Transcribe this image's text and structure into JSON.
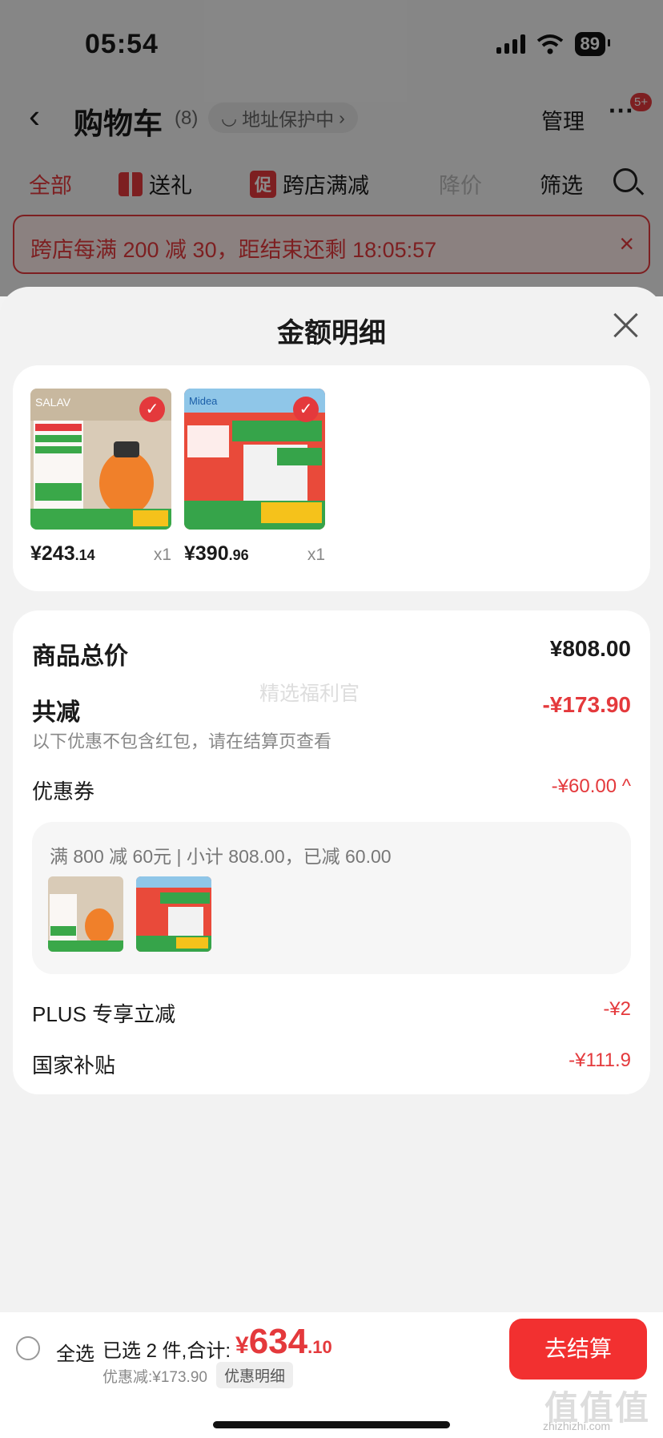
{
  "status": {
    "time": "05:54",
    "battery": "89"
  },
  "nav": {
    "back": "‹",
    "title": "购物车",
    "count": "(8)",
    "address_protect": "地址保护中",
    "manage": "管理",
    "more": "···",
    "badge": "5+"
  },
  "tabs": {
    "all": "全部",
    "gift": "送礼",
    "promo_tag": "促",
    "promo": "跨店满减",
    "drop": "降价",
    "filter": "筛选"
  },
  "banner": {
    "text": "跨店每满 200 减 30，距结束还剩 18:05:57",
    "close": "×"
  },
  "sheet": {
    "title": "金额明细",
    "products": [
      {
        "price_int": "¥243",
        "price_dec": ".14",
        "qty": "x1",
        "brand": "SALAV",
        "img_colors": [
          "#d9cbb7",
          "#f0802a",
          "#3aa849"
        ]
      },
      {
        "price_int": "¥390",
        "price_dec": ".96",
        "qty": "x1",
        "brand": "Midea",
        "img_colors": [
          "#e94a3a",
          "#f2f2f2",
          "#36a44a"
        ]
      }
    ],
    "summary": {
      "goods_total_label": "商品总价",
      "goods_total": "¥808.00",
      "total_reduce_label": "共减",
      "total_reduce": "-¥173.90",
      "note": "以下优惠不包含红包，请在结算页查看",
      "watermark": "精选福利官",
      "coupon_label": "优惠券",
      "coupon_value": "-¥60.00 ^",
      "coupon_detail": "满 800 减 60元 | 小计 808.00，已减 60.00",
      "plus_label": "PLUS 专享立减",
      "plus_value": "-¥2",
      "subsidy_label": "国家补贴",
      "subsidy_value": "-¥111.9"
    }
  },
  "bottom": {
    "select_all": "全选",
    "selected": "已选 2 件,合计:",
    "currency": "¥",
    "total_int": "634",
    "total_dec": ".10",
    "discount": "优惠减:¥173.90",
    "detail": "优惠明细",
    "checkout": "去结算",
    "watermark_logo": "值值值",
    "watermark_url": "zhizhizhi.com"
  },
  "colors": {
    "accent": "#e4393c",
    "checkout": "#f23030"
  }
}
